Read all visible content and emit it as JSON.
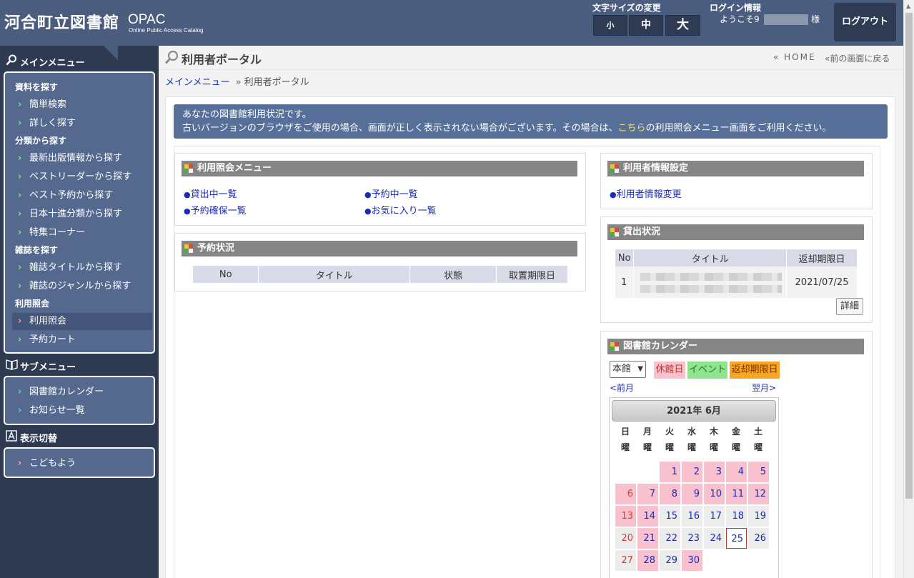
{
  "header": {
    "logo_main": "河合町立図書館",
    "logo_opac": "OPAC",
    "logo_opac_sub": "Online Public Access Catalog",
    "font_size_label": "文字サイズの変更",
    "font_sizes": [
      "小",
      "中",
      "大"
    ],
    "login_label": "ログイン情報",
    "welcome_prefix": "ようこそ9",
    "welcome_suffix": "様",
    "logout_label": "ログアウト"
  },
  "sidebar": {
    "main_menu_title": "メインメニュー",
    "sections": [
      {
        "title": "資料を探す",
        "items": [
          "簡単検索",
          "詳しく探す"
        ]
      },
      {
        "title": "分類から探す",
        "items": [
          "最新出版情報から探す",
          "ベストリーダーから探す",
          "ベスト予約から探す",
          "日本十進分類から探す",
          "特集コーナー"
        ]
      },
      {
        "title": "雑誌を探す",
        "items": [
          "雑誌タイトルから探す",
          "雑誌のジャンルから探す"
        ]
      },
      {
        "title": "利用照会",
        "items": [
          "利用照会",
          "予約カート"
        ]
      }
    ],
    "sub_menu_title": "サブメニュー",
    "sub_items": [
      "図書館カレンダー",
      "お知らせ一覧"
    ],
    "display_title": "表示切替",
    "display_items": [
      "こどもよう"
    ]
  },
  "main": {
    "page_title": "利用者ポータル",
    "home_link": "« HOME",
    "back_link": "«前の画面に戻る",
    "breadcrumb": [
      "メインメニュー",
      "»",
      "利用者ポータル"
    ],
    "notice_line1": "あなたの図書館利用状況です。",
    "notice_line2_a": "古いバージョンのブラウザをご使用の場合、画面が正しく表示されない場合がございます。その場合は、",
    "notice_link": "こちら",
    "notice_line2_b": "の利用照会メニュー画面をご利用ください。"
  },
  "panels": {
    "menu": {
      "title": "利用照会メニュー",
      "links": [
        "貸出中一覧",
        "予約中一覧",
        "予約確保一覧",
        "お気に入り一覧"
      ]
    },
    "reservations": {
      "title": "予約状況",
      "columns": [
        "No",
        "タイトル",
        "状態",
        "取置期限日"
      ]
    },
    "user_settings": {
      "title": "利用者情報設定",
      "links": [
        "利用者情報変更"
      ]
    },
    "loans": {
      "title": "貸出状況",
      "columns": [
        "No",
        "タイトル",
        "返却期限日"
      ],
      "rows": [
        {
          "no": "1",
          "title": "",
          "due": "2021/07/25"
        }
      ],
      "detail_button": "詳細"
    },
    "calendar": {
      "title": "図書館カレンダー",
      "branch": "本館",
      "legend": [
        "休館日",
        "イベント",
        "返却期限日"
      ],
      "legend_colors": [
        "#f9c0cd",
        "#8ee58e",
        "#f5a623"
      ],
      "prev": "<前月",
      "next": "翌月>",
      "month_label": "2021年 6月",
      "weekday_chars": [
        "日",
        "月",
        "火",
        "水",
        "木",
        "金",
        "土"
      ],
      "weekday_suffix": "曜",
      "days": [
        "1",
        "2",
        "3",
        "4",
        "5",
        "6",
        "7",
        "8",
        "9",
        "10",
        "11",
        "12",
        "13",
        "14",
        "15",
        "16",
        "17",
        "18",
        "19",
        "20",
        "21",
        "22",
        "23",
        "24",
        "25",
        "26",
        "27",
        "28",
        "29",
        "30"
      ],
      "closed_days": [
        1,
        2,
        3,
        4,
        5,
        6,
        7,
        8,
        9,
        10,
        11,
        12,
        13,
        14,
        21,
        28,
        30
      ],
      "today": 25
    }
  }
}
